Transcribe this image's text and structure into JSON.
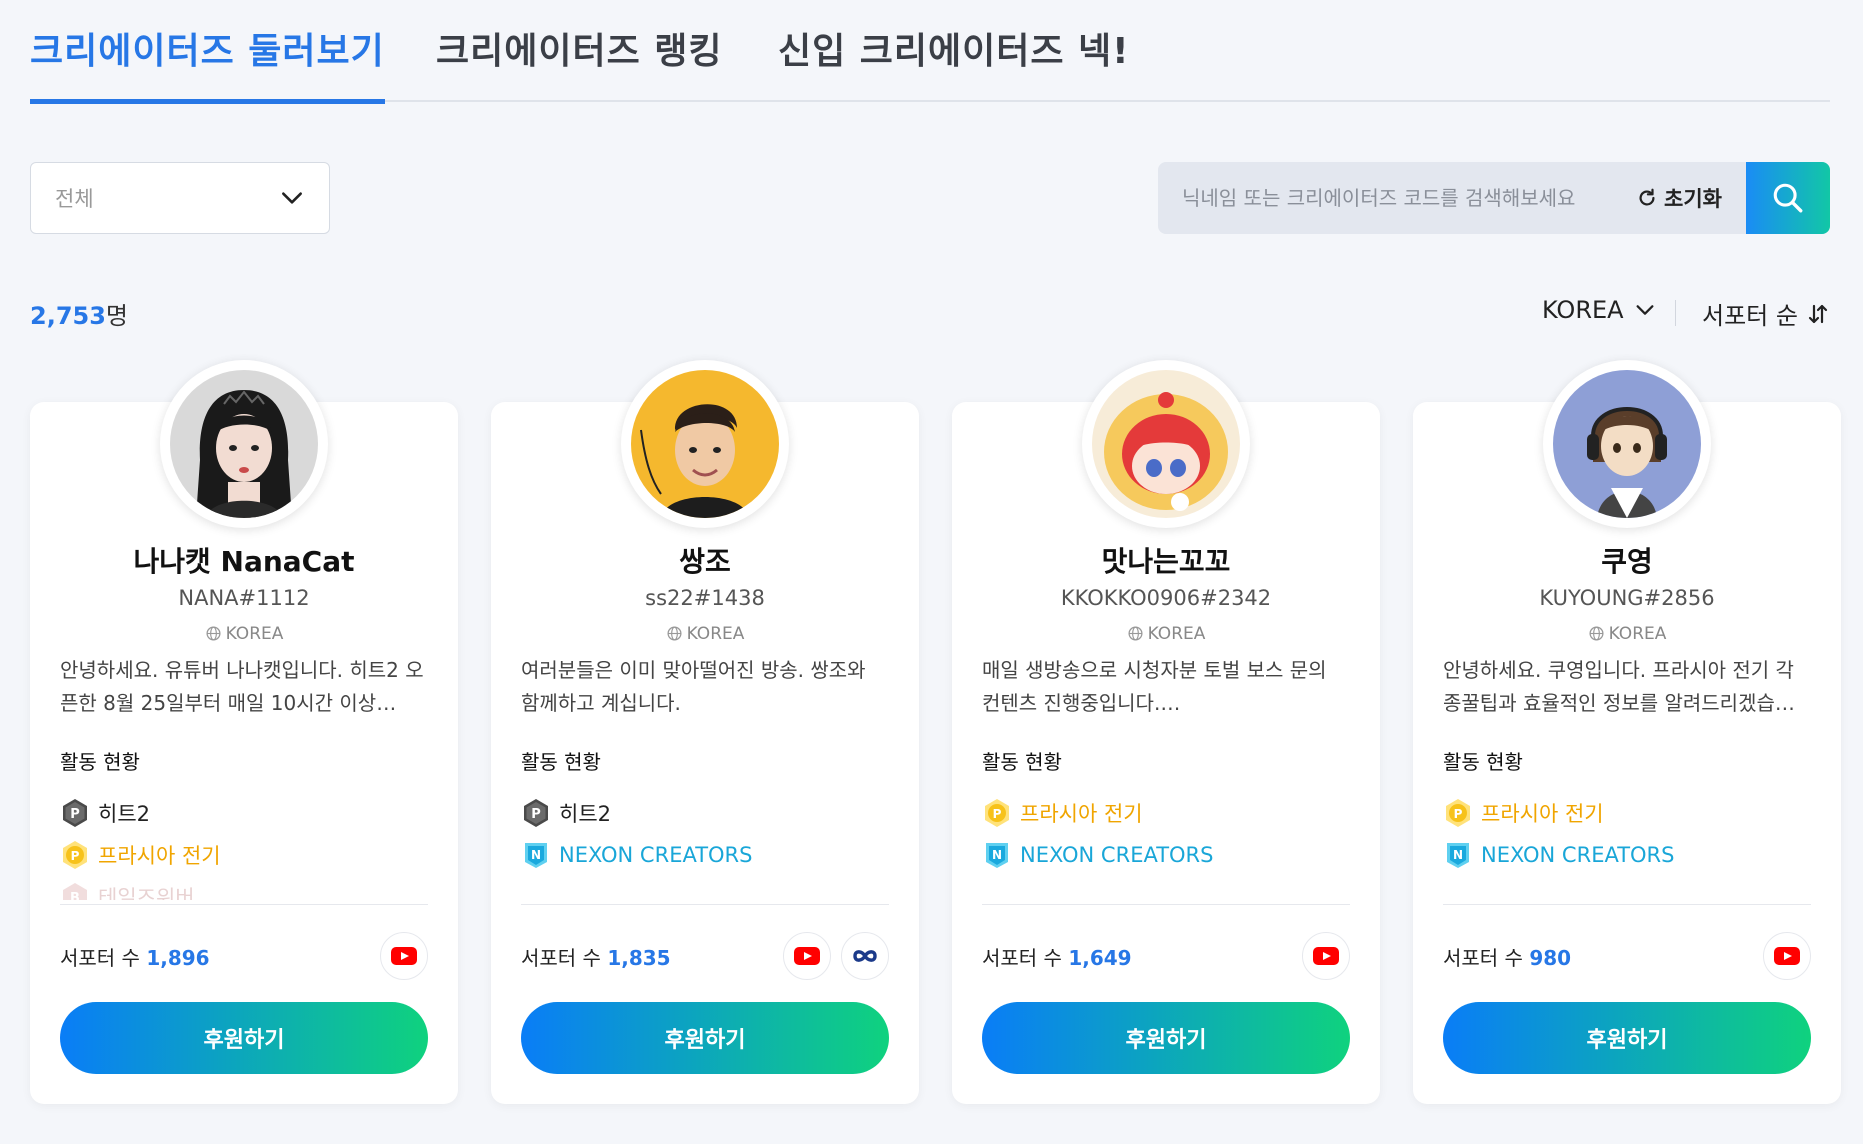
{
  "tabs": [
    "크리에이터즈 둘러보기",
    "크리에이터즈 랭킹",
    "신입 크리에이터즈 넥!"
  ],
  "filter": {
    "selected": "전체"
  },
  "search": {
    "placeholder": "닉네임 또는 크리에이터즈 코드를 검색해보세요",
    "reset_label": "초기화"
  },
  "count": {
    "value": "2,753",
    "unit": "명"
  },
  "country_select": "KOREA",
  "sort_select": "서포터 순",
  "card_labels": {
    "activity_title": "활동 현황",
    "supporters_label": "서포터 수",
    "sponsor_button": "후원하기"
  },
  "colors": {
    "accent": "#2777e6",
    "gradient_start": "#0a7df7",
    "gradient_end": "#0fd27e",
    "game_p_gray": "#555555",
    "game_p_gold": "#f5b800",
    "nexon_cyan": "#19b6e6"
  },
  "cards": [
    {
      "name": "나나캣 NanaCat",
      "code": "NANA#1112",
      "country": "KOREA",
      "description": "안녕하세요. 유튜버 나나캣입니다.   히트2 오픈한 8월 25일부터 매일 10시간 이상…",
      "activities": [
        {
          "label": "히트2",
          "icon": "p-badge-gray-icon",
          "color": "#222222"
        },
        {
          "label": "프라시아 전기",
          "icon": "p-badge-gold-icon",
          "color": "#f0a500"
        },
        {
          "label": "테일즈위버",
          "icon": "b-badge-icon",
          "color": "#c08080"
        }
      ],
      "supporters": "1,896",
      "socials": [
        "youtube-icon"
      ]
    },
    {
      "name": "쌍조",
      "code": "ss22#1438",
      "country": "KOREA",
      "description": "여러분들은 이미 맞아떨어진 방송. 쌍조와 함께하고 계십니다.",
      "activities": [
        {
          "label": "히트2",
          "icon": "p-badge-gray-icon",
          "color": "#222222"
        },
        {
          "label": "NEXON CREATORS",
          "icon": "nexon-badge-icon",
          "color": "#19a6d8"
        }
      ],
      "supporters": "1,835",
      "socials": [
        "youtube-icon",
        "infinity-icon"
      ]
    },
    {
      "name": "맛나는꼬꼬",
      "code": "KKOKKO0906#2342",
      "country": "KOREA",
      "description": "매일 생방송으로 시청자분 토벌 보스 문의 컨텐츠 진행중입니다.…",
      "activities": [
        {
          "label": "프라시아 전기",
          "icon": "p-badge-gold-icon",
          "color": "#f0a500"
        },
        {
          "label": "NEXON CREATORS",
          "icon": "nexon-badge-icon",
          "color": "#19a6d8"
        }
      ],
      "supporters": "1,649",
      "socials": [
        "youtube-icon"
      ]
    },
    {
      "name": "쿠영",
      "code": "KUYOUNG#2856",
      "country": "KOREA",
      "description": "안녕하세요. 쿠영입니다. 프라시아 전기 각종꿀팁과 효율적인 정보를 알려드리겠습…",
      "activities": [
        {
          "label": "프라시아 전기",
          "icon": "p-badge-gold-icon",
          "color": "#f0a500"
        },
        {
          "label": "NEXON CREATORS",
          "icon": "nexon-badge-icon",
          "color": "#19a6d8"
        }
      ],
      "supporters": "980",
      "socials": [
        "youtube-icon"
      ]
    }
  ]
}
